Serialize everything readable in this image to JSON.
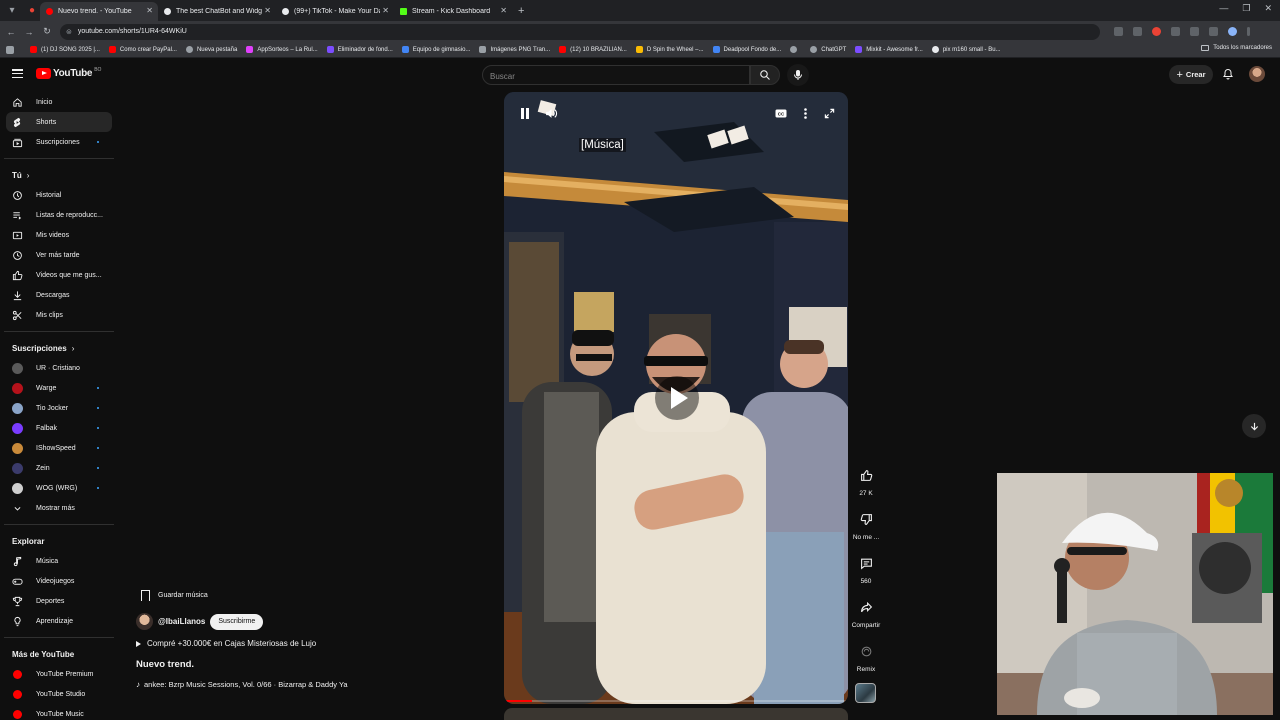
{
  "browser": {
    "tabs": [
      {
        "label": "Nuevo trend. - YouTube",
        "active": true,
        "favicon_color": "#ff0000"
      },
      {
        "label": "The best ChatBot and Widgets",
        "active": false,
        "favicon_color": "#e8eaed"
      },
      {
        "label": "(99+) TikTok - Make Your Day",
        "active": false,
        "favicon_color": "#e8eaed"
      },
      {
        "label": "Stream - Kick Dashboard",
        "active": false,
        "favicon_color": "#53fc18"
      }
    ],
    "url": "youtube.com/shorts/1UR4-64WKiU",
    "bookmarks": [
      {
        "label": "(1) DJ SONG 2025 |...",
        "color": "#ff0000"
      },
      {
        "label": "Como crear PayPal...",
        "color": "#ff0000"
      },
      {
        "label": "Nueva pestaña",
        "color": "#9aa0a6"
      },
      {
        "label": "AppSorteos – La Rul...",
        "color": "#e040fb"
      },
      {
        "label": "Eliminador de fond...",
        "color": "#7c4dff"
      },
      {
        "label": "Equipo de gimnasio...",
        "color": "#4285f4"
      },
      {
        "label": "Imágenes PNG Tran...",
        "color": "#9aa0a6"
      },
      {
        "label": "(12) 10 BRAZILIAN...",
        "color": "#ff0000"
      },
      {
        "label": "D Spin the Wheel –...",
        "color": "#fbbc04"
      },
      {
        "label": "Deadpool Fondo de...",
        "color": "#4285f4"
      },
      {
        "label": "",
        "color": "#9aa0a6"
      },
      {
        "label": "ChatGPT",
        "color": "#9aa0a6"
      },
      {
        "label": "Mixkit - Awesome fr...",
        "color": "#7c4dff"
      },
      {
        "label": "pix m160 small - Bu...",
        "color": "#e8eaed"
      }
    ],
    "all_bookmarks": "Todos los marcadores"
  },
  "header": {
    "logo_text": "YouTube",
    "logo_country": "BO",
    "search_placeholder": "Buscar",
    "create_label": "Crear"
  },
  "sidebar": {
    "main": [
      {
        "label": "Inicio",
        "icon": "home-icon"
      },
      {
        "label": "Shorts",
        "icon": "shorts-icon",
        "active": true
      },
      {
        "label": "Suscripciones",
        "icon": "subscriptions-icon",
        "dot": true
      }
    ],
    "you_heading": "Tú",
    "you": [
      {
        "label": "Historial",
        "icon": "history-icon"
      },
      {
        "label": "Listas de reproducc...",
        "icon": "playlists-icon"
      },
      {
        "label": "Mis videos",
        "icon": "my-videos-icon"
      },
      {
        "label": "Ver más tarde",
        "icon": "watch-later-icon"
      },
      {
        "label": "Videos que me gus...",
        "icon": "liked-icon"
      },
      {
        "label": "Descargas",
        "icon": "downloads-icon"
      },
      {
        "label": "Mis clips",
        "icon": "clips-icon"
      }
    ],
    "subs_heading": "Suscripciones",
    "subs": [
      {
        "label": "UR · Cristiano",
        "color": "#5a5a5a",
        "dot": false
      },
      {
        "label": "Warge",
        "color": "#b5121b",
        "dot": true
      },
      {
        "label": "Tio Jocker",
        "color": "#8aa4c8",
        "dot": true
      },
      {
        "label": "Falbak",
        "color": "#7a3cff",
        "dot": true
      },
      {
        "label": "IShowSpeed",
        "color": "#c98a3a",
        "dot": true
      },
      {
        "label": "Zein",
        "color": "#3b3b6b",
        "dot": true
      },
      {
        "label": "WOG (WRG)",
        "color": "#cfcfcf",
        "dot": true
      }
    ],
    "show_more": "Mostrar más",
    "explore_heading": "Explorar",
    "explore": [
      {
        "label": "Música",
        "icon": "music-icon"
      },
      {
        "label": "Videojuegos",
        "icon": "gaming-icon"
      },
      {
        "label": "Deportes",
        "icon": "sports-icon"
      },
      {
        "label": "Aprendizaje",
        "icon": "learning-icon"
      }
    ],
    "more_heading": "Más de YouTube",
    "more": [
      {
        "label": "YouTube Premium"
      },
      {
        "label": "YouTube Studio"
      },
      {
        "label": "YouTube Music"
      }
    ]
  },
  "player": {
    "caption": "[Música]",
    "progress_fraction": 0.08
  },
  "short": {
    "save_music": "Guardar música",
    "channel": "@IbaiLlanos",
    "subscribe": "Suscribirme",
    "related_video": "Compré +30.000€ en Cajas Misteriosas de Lujo",
    "title": "Nuevo trend.",
    "music": "ankee: Bzrp Music Sessions, Vol. 0/66 · Bizarrap & Daddy Ya"
  },
  "actions": {
    "likes": "27 K",
    "dislike": "No me ...",
    "comments": "560",
    "share": "Compartir",
    "remix": "Remix"
  },
  "colors": {
    "background": "#0f0f0f",
    "accent_red": "#ff0000",
    "subscribed_dot": "#3ea6ff"
  }
}
